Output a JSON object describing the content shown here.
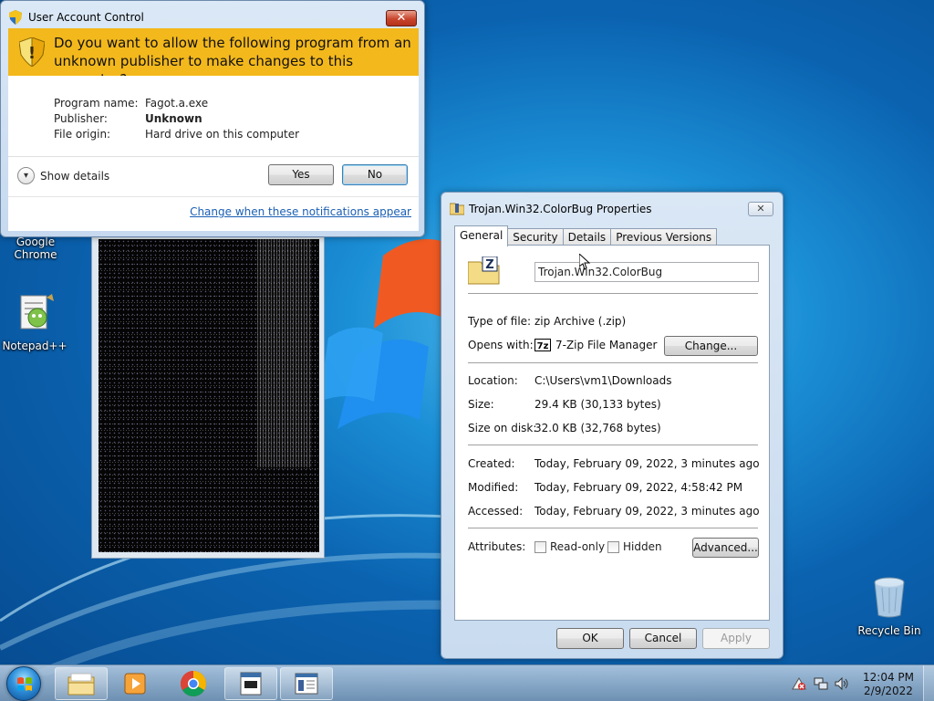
{
  "desktop": {
    "icons": [
      {
        "label": "Google Chrome",
        "icon": "chrome-icon"
      },
      {
        "label": "Notepad++",
        "icon": "notepadpp-icon"
      },
      {
        "label": "Recycle Bin",
        "icon": "recycle-bin-icon"
      }
    ]
  },
  "uac": {
    "title": "User Account Control",
    "question": "Do you want to allow the following program from an unknown publisher to make changes to this computer?",
    "fields": [
      {
        "key": "Program name:",
        "value": "Fagot.a.exe",
        "bold": false
      },
      {
        "key": "Publisher:",
        "value": "Unknown",
        "bold": true
      },
      {
        "key": "File origin:",
        "value": "Hard drive on this computer",
        "bold": false
      }
    ],
    "show_details": "Show details",
    "yes": "Yes",
    "no": "No",
    "link": "Change when these notifications appear",
    "banner_color": "#f3b81c"
  },
  "properties": {
    "title": "Trojan.Win32.ColorBug Properties",
    "tabs": [
      "General",
      "Security",
      "Details",
      "Previous Versions"
    ],
    "filename": "Trojan.Win32.ColorBug",
    "type_label": "Type of file:",
    "type_value": "zip Archive (.zip)",
    "opens_label": "Opens with:",
    "opens_value": "7-Zip File Manager",
    "change_button": "Change...",
    "location_label": "Location:",
    "location_value": "C:\\Users\\vm1\\Downloads",
    "size_label": "Size:",
    "size_value": "29.4 KB (30,133 bytes)",
    "disk_label": "Size on disk:",
    "disk_value": "32.0 KB (32,768 bytes)",
    "created_label": "Created:",
    "created_value": "Today, February 09, 2022, 3 minutes ago",
    "modified_label": "Modified:",
    "modified_value": "Today, February 09, 2022, 4:58:42 PM",
    "accessed_label": "Accessed:",
    "accessed_value": "Today, February 09, 2022, 3 minutes ago",
    "attributes_label": "Attributes:",
    "readonly_label": "Read-only",
    "hidden_label": "Hidden",
    "advanced_button": "Advanced...",
    "ok": "OK",
    "cancel": "Cancel",
    "apply": "Apply"
  },
  "taskbar": {
    "pinned": [
      "explorer-icon",
      "media-player-icon",
      "chrome-icon",
      "program-window-icon",
      "properties-window-icon"
    ],
    "tray": [
      "action-center-icon",
      "network-icon",
      "volume-icon"
    ],
    "time": "12:04 PM",
    "date": "2/9/2022"
  }
}
